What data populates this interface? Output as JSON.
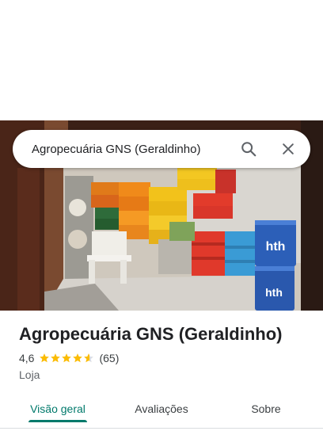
{
  "search": {
    "query": "Agropecuária GNS (Geraldinho)"
  },
  "icons": {
    "search": "search-icon",
    "close": "close-icon",
    "star": "star-icon"
  },
  "place": {
    "name": "Agropecuária GNS (Geraldinho)",
    "rating": "4,6",
    "rating_stars": 4.6,
    "review_count": "(65)",
    "category": "Loja"
  },
  "photo": {
    "tub_brand": "hth"
  },
  "tabs": [
    {
      "label": "Visão geral",
      "selected": true
    },
    {
      "label": "Avaliações",
      "selected": false
    },
    {
      "label": "Sobre",
      "selected": false
    }
  ],
  "colors": {
    "accent": "#00796b",
    "star": "#fbbc04",
    "star_empty": "#dadce0",
    "text": "#202124"
  }
}
